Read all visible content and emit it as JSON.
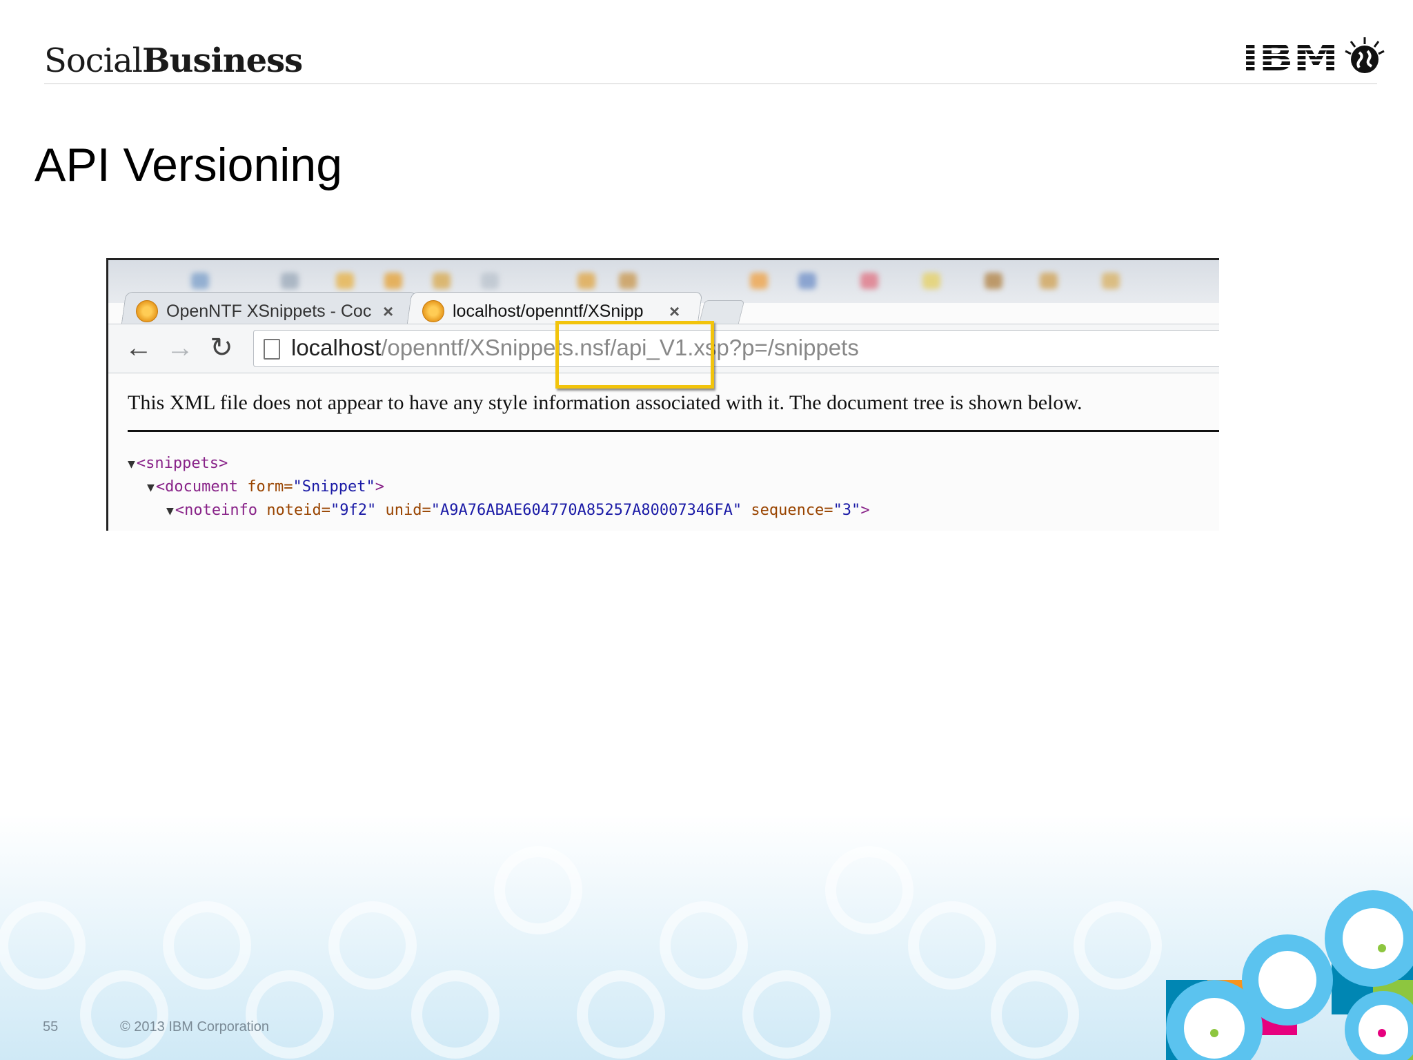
{
  "header": {
    "brand_part1": "Social",
    "brand_part2": "Business",
    "logo_text": "IBM"
  },
  "slide": {
    "title": "API Versioning"
  },
  "browser": {
    "tabs": [
      {
        "title": "OpenNTF XSnippets - Coc",
        "active": false
      },
      {
        "title": "localhost/openntf/XSnipp",
        "active": true
      }
    ],
    "close_glyph": "×",
    "nav": {
      "back_icon": "←",
      "forward_icon": "→",
      "reload_icon": "↻"
    },
    "address": {
      "host": "localhost",
      "path": "/openntf/XSnippets.nsf/api_V1.xsp?p=/snippets"
    },
    "highlight_color": "#f2c40c"
  },
  "xml_view": {
    "message": "This XML file does not appear to have any style information associated with it. The document tree is shown below.",
    "lines": [
      {
        "arrow": "▼",
        "open": "<snippets>"
      },
      {
        "arrow": "▼",
        "open": "<document",
        "attr1": "form=",
        "val1": "\"Snippet\"",
        "close": ">"
      },
      {
        "arrow": "▼",
        "open": "<noteinfo",
        "attr1": "noteid=",
        "val1": "\"9f2\"",
        "attr2": "unid=",
        "val2": "\"A9A76ABAE604770A85257A80007346FA\"",
        "attr3": "sequence=",
        "val3": "\"3\"",
        "close": ">"
      }
    ]
  },
  "footer": {
    "page_number": "55",
    "copyright": "© 2013 IBM Corporation"
  },
  "colors": {
    "accent_blue": "#5bc3ef",
    "accent_orange": "#f7941d",
    "accent_pink": "#e6007e",
    "accent_green": "#8dc63f",
    "accent_teal": "#0086b3"
  }
}
